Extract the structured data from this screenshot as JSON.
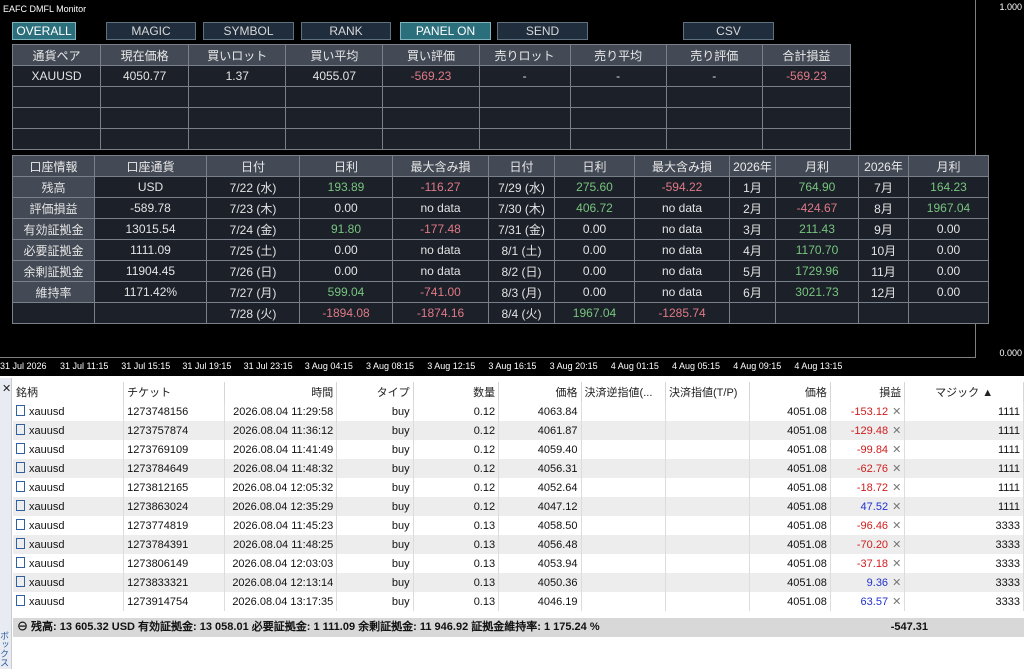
{
  "window_title": "EAFC DMFL Monitor",
  "buttons": [
    {
      "label": "OVERALL",
      "active": true
    },
    {
      "label": "MAGIC",
      "active": false
    },
    {
      "label": "SYMBOL",
      "active": false
    },
    {
      "label": "RANK",
      "active": false
    },
    {
      "label": "PANEL ON",
      "active": true
    },
    {
      "label": "SEND",
      "active": false
    },
    {
      "label": "CSV",
      "active": false
    }
  ],
  "y_axis": {
    "top": "1.000",
    "bottom": "0.000"
  },
  "x_axis": [
    "31 Jul 2026",
    "31 Jul 11:15",
    "31 Jul 15:15",
    "31 Jul 19:15",
    "31 Jul 23:15",
    "3 Aug 04:15",
    "3 Aug 08:15",
    "3 Aug 12:15",
    "3 Aug 16:15",
    "3 Aug 20:15",
    "4 Aug 01:15",
    "4 Aug 05:15",
    "4 Aug 09:15",
    "4 Aug 13:15"
  ],
  "pairs": {
    "headers": [
      "通貨ペア",
      "現在価格",
      "買いロット",
      "買い平均",
      "買い評価",
      "売りロット",
      "売り平均",
      "売り評価",
      "合計損益"
    ],
    "row": [
      "XAUUSD",
      "4050.77",
      "1.37",
      "4055.07",
      "-569.23",
      "-",
      "-",
      "-",
      "-569.23"
    ]
  },
  "account": {
    "headers": [
      "口座情報",
      "口座通貨",
      "日付",
      "日利",
      "最大含み損",
      "日付",
      "日利",
      "最大含み損",
      "2026年",
      "月利",
      "2026年",
      "月利"
    ],
    "rows": [
      [
        "残高",
        "USD",
        "7/22 (水)",
        "193.89",
        "-116.27",
        "7/29 (水)",
        "275.60",
        "-594.22",
        "1月",
        "764.90",
        "7月",
        "164.23"
      ],
      [
        "評価損益",
        "-589.78",
        "7/23 (木)",
        "0.00",
        "no data",
        "7/30 (木)",
        "406.72",
        "no data",
        "2月",
        "-424.67",
        "8月",
        "1967.04"
      ],
      [
        "有効証拠金",
        "13015.54",
        "7/24 (金)",
        "91.80",
        "-177.48",
        "7/31 (金)",
        "0.00",
        "no data",
        "3月",
        "211.43",
        "9月",
        "0.00"
      ],
      [
        "必要証拠金",
        "1111.09",
        "7/25 (土)",
        "0.00",
        "no data",
        "8/1 (土)",
        "0.00",
        "no data",
        "4月",
        "1170.70",
        "10月",
        "0.00"
      ],
      [
        "余剰証拠金",
        "11904.45",
        "7/26 (日)",
        "0.00",
        "no data",
        "8/2 (日)",
        "0.00",
        "no data",
        "5月",
        "1729.96",
        "11月",
        "0.00"
      ],
      [
        "維持率",
        "1171.42%",
        "7/27 (月)",
        "599.04",
        "-741.00",
        "8/3 (月)",
        "0.00",
        "no data",
        "6月",
        "3021.73",
        "12月",
        "0.00"
      ],
      [
        "",
        "",
        "7/28 (火)",
        "-1894.08",
        "-1874.16",
        "8/4 (火)",
        "1967.04",
        "-1285.74",
        "",
        "",
        "",
        ""
      ]
    ]
  },
  "terminal": {
    "close": "✕",
    "side_label": "ボックス",
    "headers": [
      "銘柄",
      "チケット",
      "時間",
      "タイプ",
      "数量",
      "価格",
      "決済逆指値(...",
      "決済指値(T/P)",
      "価格",
      "損益",
      "マジック ▲"
    ],
    "rows": [
      [
        "xauusd",
        "1273748156",
        "2026.08.04 11:29:58",
        "buy",
        "0.12",
        "4063.84",
        "",
        "",
        "4051.08",
        "-153.12",
        "1111"
      ],
      [
        "xauusd",
        "1273757874",
        "2026.08.04 11:36:12",
        "buy",
        "0.12",
        "4061.87",
        "",
        "",
        "4051.08",
        "-129.48",
        "1111"
      ],
      [
        "xauusd",
        "1273769109",
        "2026.08.04 11:41:49",
        "buy",
        "0.12",
        "4059.40",
        "",
        "",
        "4051.08",
        "-99.84",
        "1111"
      ],
      [
        "xauusd",
        "1273784649",
        "2026.08.04 11:48:32",
        "buy",
        "0.12",
        "4056.31",
        "",
        "",
        "4051.08",
        "-62.76",
        "1111"
      ],
      [
        "xauusd",
        "1273812165",
        "2026.08.04 12:05:32",
        "buy",
        "0.12",
        "4052.64",
        "",
        "",
        "4051.08",
        "-18.72",
        "1111"
      ],
      [
        "xauusd",
        "1273863024",
        "2026.08.04 12:35:29",
        "buy",
        "0.12",
        "4047.12",
        "",
        "",
        "4051.08",
        "47.52",
        "1111"
      ],
      [
        "xauusd",
        "1273774819",
        "2026.08.04 11:45:23",
        "buy",
        "0.13",
        "4058.50",
        "",
        "",
        "4051.08",
        "-96.46",
        "3333"
      ],
      [
        "xauusd",
        "1273784391",
        "2026.08.04 11:48:25",
        "buy",
        "0.13",
        "4056.48",
        "",
        "",
        "4051.08",
        "-70.20",
        "3333"
      ],
      [
        "xauusd",
        "1273806149",
        "2026.08.04 12:03:03",
        "buy",
        "0.13",
        "4053.94",
        "",
        "",
        "4051.08",
        "-37.18",
        "3333"
      ],
      [
        "xauusd",
        "1273833321",
        "2026.08.04 12:13:14",
        "buy",
        "0.13",
        "4050.36",
        "",
        "",
        "4051.08",
        "9.36",
        "3333"
      ],
      [
        "xauusd",
        "1273914754",
        "2026.08.04 13:17:35",
        "buy",
        "0.13",
        "4046.19",
        "",
        "",
        "4051.08",
        "63.57",
        "3333"
      ]
    ],
    "summary": "⊖ 残高: 13 605.32 USD  有効証拠金: 13 058.01  必要証拠金: 1 111.09  余剰証拠金: 11 946.92  証拠金維持率: 1 175.24 %",
    "summary_total": "-547.31"
  }
}
